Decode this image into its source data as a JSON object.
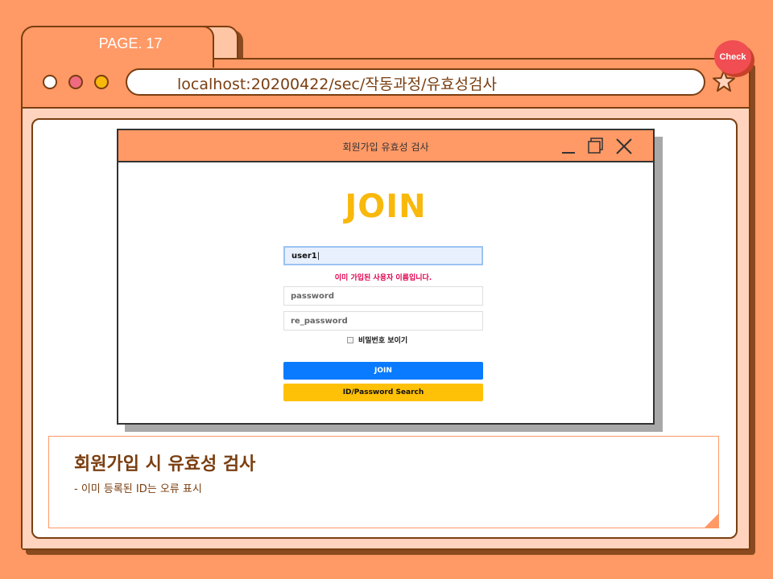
{
  "tab": {
    "label": "PAGE. 17"
  },
  "browser": {
    "url": "localhost:20200422/sec/작동과정/유효성검사",
    "check_badge": "Check",
    "colors": {
      "background": "#FF9966",
      "frame_border": "#7a3e10",
      "content_bg": "#FFD3BE"
    }
  },
  "window": {
    "title": "회원가입 유효성 검사",
    "form": {
      "heading": "JOIN",
      "username_value": "user1",
      "error_message": "이미 가입된 사용자 이름입니다.",
      "password_placeholder": "password",
      "repassword_placeholder": "re_password",
      "show_password_label": "비밀번호 보이기",
      "join_button": "JOIN",
      "search_button": "ID/Password Search"
    }
  },
  "caption": {
    "title": "회원가입 시 유효성 검사",
    "description": "-  이미 등록된 ID는 오류 표시"
  }
}
